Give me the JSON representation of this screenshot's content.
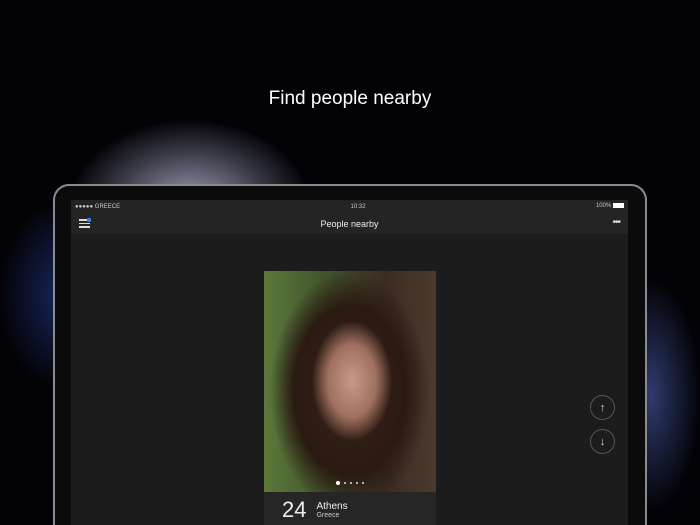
{
  "headline": "Find people nearby",
  "status": {
    "carrier": "●●●●● GREECE",
    "time": "10:32",
    "battery": "100%"
  },
  "nav": {
    "title": "People nearby",
    "more": "•••"
  },
  "profile": {
    "age": "24",
    "city": "Athens",
    "country": "Greece",
    "photo_count": 5,
    "active_photo": 1
  },
  "controls": {
    "up": "↑",
    "down": "↓"
  },
  "colors": {
    "accent": "#2f7cf6"
  }
}
